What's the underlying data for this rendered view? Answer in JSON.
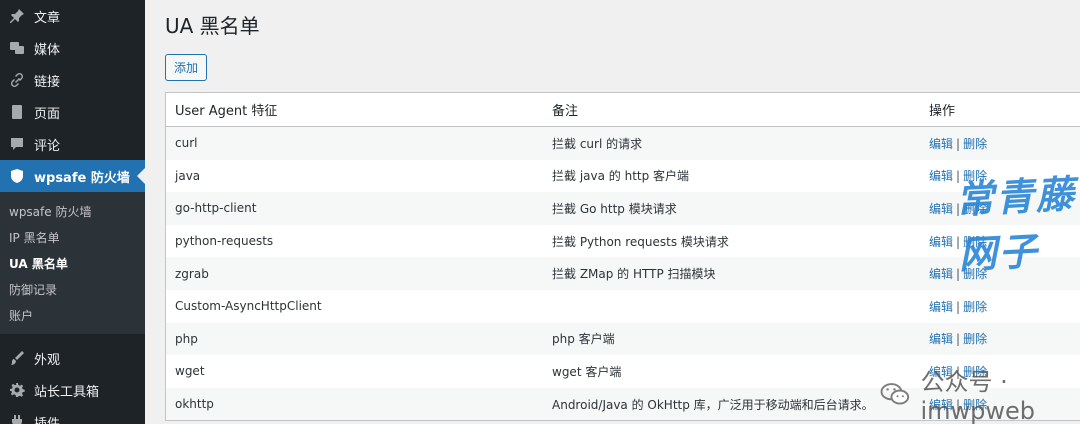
{
  "sidebar": {
    "items": [
      {
        "label": "文章",
        "icon": "pin-icon"
      },
      {
        "label": "媒体",
        "icon": "media-icon"
      },
      {
        "label": "链接",
        "icon": "link-icon"
      },
      {
        "label": "页面",
        "icon": "page-icon"
      },
      {
        "label": "评论",
        "icon": "comment-icon"
      },
      {
        "label": "wpsafe 防火墙",
        "icon": "shield-icon"
      }
    ],
    "submenu": [
      "wpsafe 防火墙",
      "IP 黑名单",
      "UA 黑名单",
      "防御记录",
      "账户"
    ],
    "bottom_items": [
      {
        "label": "外观",
        "icon": "brush-icon"
      },
      {
        "label": "站长工具箱",
        "icon": "gear-icon"
      },
      {
        "label": "插件",
        "icon": "plugin-icon"
      }
    ]
  },
  "page": {
    "title": "UA 黑名单",
    "add_label": "添加"
  },
  "table": {
    "headers": [
      "User Agent 特征",
      "备注",
      "操作"
    ],
    "edit_label": "编辑",
    "delete_label": "删除",
    "separator": "|",
    "rows": [
      {
        "ua": "curl",
        "note": "拦截 curl 的请求"
      },
      {
        "ua": "java",
        "note": "拦截 java 的 http 客户端"
      },
      {
        "ua": "go-http-client",
        "note": "拦截 Go http 模块请求"
      },
      {
        "ua": "python-requests",
        "note": "拦截 Python requests 模块请求"
      },
      {
        "ua": "zgrab",
        "note": "拦截 ZMap 的 HTTP 扫描模块"
      },
      {
        "ua": "Custom-AsyncHttpClient",
        "note": ""
      },
      {
        "ua": "php",
        "note": "php 客户端"
      },
      {
        "ua": "wget",
        "note": "wget 客户端"
      },
      {
        "ua": "okhttp",
        "note": "Android/Java 的 OkHttp 库，广泛用于移动端和后台请求。"
      }
    ]
  },
  "watermark": {
    "brand": "常青藤网子",
    "wechat": "公众号 · imwpweb"
  },
  "colors": {
    "sidebar_bg": "#1d2327",
    "accent": "#2271b1",
    "link": "#2271b1"
  }
}
